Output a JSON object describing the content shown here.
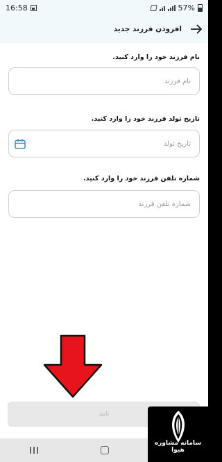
{
  "status_bar": {
    "time": "16:58",
    "battery": "57%",
    "icons": [
      "gallery-icon",
      "mute-icon",
      "wifi-calling-icon",
      "signal-icon",
      "battery-icon"
    ]
  },
  "header": {
    "title": "افزودن فرزند جدید",
    "back_icon": "arrow-right-icon"
  },
  "form": {
    "name_label": "نام فرزند خود را وارد کنید.",
    "name_placeholder": "نام فرزند",
    "birthdate_label": "تاریخ تولد فرزند خود را وارد کنید.",
    "birthdate_placeholder": "تاریخ تولد",
    "phone_label": "شماره تلفن فرزند خود را وارد کنید.",
    "phone_placeholder": "شماره تلفن فرزند"
  },
  "actions": {
    "confirm_label": "تایید"
  },
  "overlay": {
    "arrow_color": "#e8141c"
  },
  "watermark": {
    "text": "سامانه مشاوره هیوا"
  },
  "colors": {
    "header_bg": "#f2f9fa",
    "accent": "#3b8fb0",
    "button_disabled": "#e8e8e8"
  }
}
